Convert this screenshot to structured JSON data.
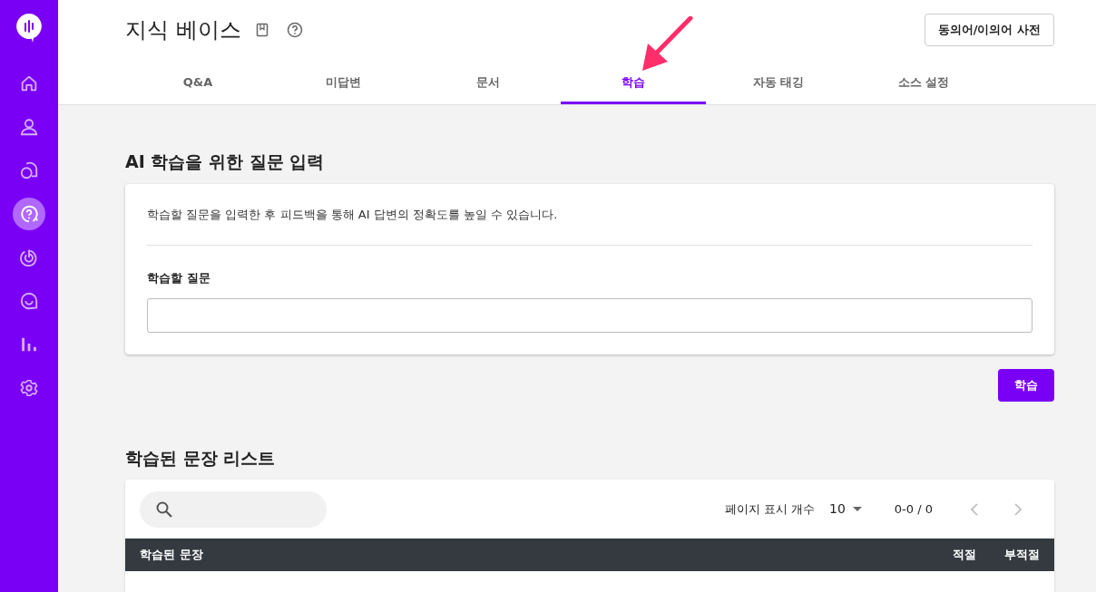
{
  "sidebar": {
    "items": [
      {
        "kind": "home",
        "selected": false
      },
      {
        "kind": "person",
        "selected": false
      },
      {
        "kind": "chat",
        "selected": false
      },
      {
        "kind": "question",
        "selected": true
      },
      {
        "kind": "target",
        "selected": false
      },
      {
        "kind": "smile",
        "selected": false
      },
      {
        "kind": "chart",
        "selected": false
      },
      {
        "kind": "gear",
        "selected": false
      }
    ]
  },
  "header": {
    "title": "지식 베이스",
    "dictionary_button": "동의어/이의어 사전"
  },
  "tabs": [
    {
      "label": "Q&A",
      "selected": false
    },
    {
      "label": "미답변",
      "selected": false
    },
    {
      "label": "문서",
      "selected": false
    },
    {
      "label": "학습",
      "selected": true
    },
    {
      "label": "자동 태깅",
      "selected": false
    },
    {
      "label": "소스 설정",
      "selected": false
    }
  ],
  "question_section": {
    "title": "AI 학습을 위한 질문 입력",
    "description": "학습할 질문을 입력한 후 피드백을 통해 AI 답변의 정확도를 높일 수 있습니다.",
    "field_label": "학습할 질문",
    "submit_button": "학습"
  },
  "list_section": {
    "title": "학습된 문장 리스트",
    "page_size_label": "페이지 표시 개수",
    "page_size": "10",
    "range": "0-0 / 0",
    "columns": [
      "학습된 문장",
      "적절",
      "부적절"
    ]
  }
}
